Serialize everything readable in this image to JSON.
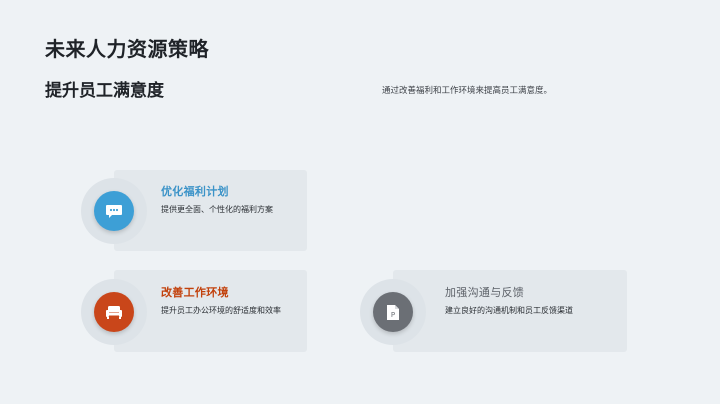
{
  "slide": {
    "title": "未来人力资源策略",
    "subtitle": "提升员工满意度",
    "description": "通过改善福利和工作环境来提高员工满意度。"
  },
  "cards": [
    {
      "title": "优化福利计划",
      "text": "提供更全面、个性化的福利方案",
      "icon": "chat-bubble-icon",
      "title_color": "#3b93c8",
      "circle_color": "#3d9fd6"
    },
    {
      "title": "改善工作环境",
      "text": "提升员工办公环境的舒适度和效率",
      "icon": "sofa-icon",
      "title_color": "#c2410c",
      "circle_color": "#c9461a"
    },
    {
      "title": "加强沟通与反馈",
      "text": "建立良好的沟通机制和员工反馈渠道",
      "icon": "document-icon",
      "title_color": "#5c6168",
      "circle_color": "#6b6f75"
    }
  ]
}
